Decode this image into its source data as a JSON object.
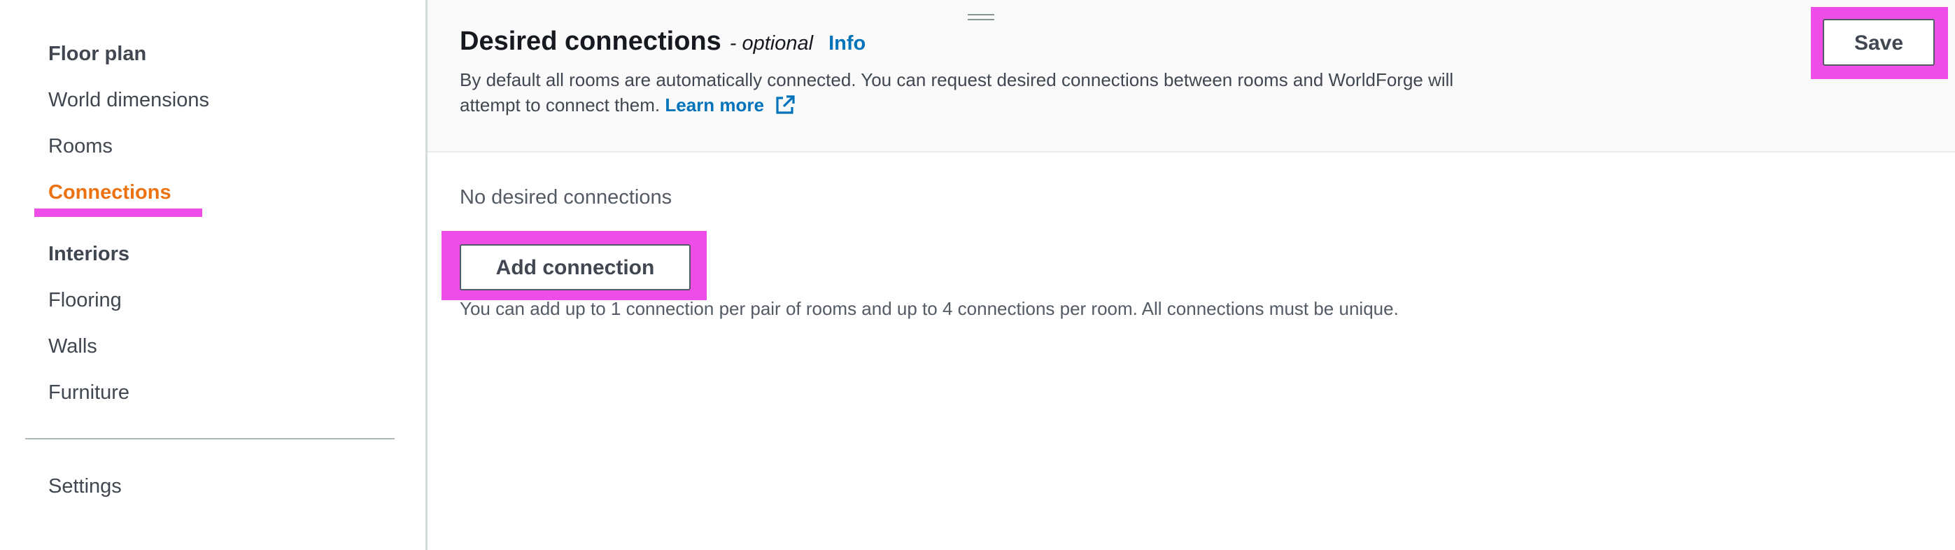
{
  "sidebar": {
    "floor_plan_heading": "Floor plan",
    "floor_plan_items": [
      "World dimensions",
      "Rooms",
      "Connections"
    ],
    "interiors_heading": "Interiors",
    "interiors_items": [
      "Flooring",
      "Walls",
      "Furniture"
    ],
    "settings": "Settings",
    "active_item": "Connections"
  },
  "header": {
    "title": "Desired connections",
    "optional": "- optional",
    "info": "Info",
    "description": "By default all rooms are automatically connected. You can request desired connections between rooms and WorldForge will attempt to connect them.",
    "learn_more": "Learn more",
    "external_icon": "external-link-icon",
    "save_label": "Save"
  },
  "content": {
    "empty_text": "No desired connections",
    "add_label": "Add connection",
    "hint": "You can add up to 1 connection per pair of rooms and up to 4 connections per room. All connections must be unique."
  },
  "colors": {
    "accent_active": "#ec7211",
    "link": "#0073bb",
    "highlight": "#ee4de8"
  }
}
